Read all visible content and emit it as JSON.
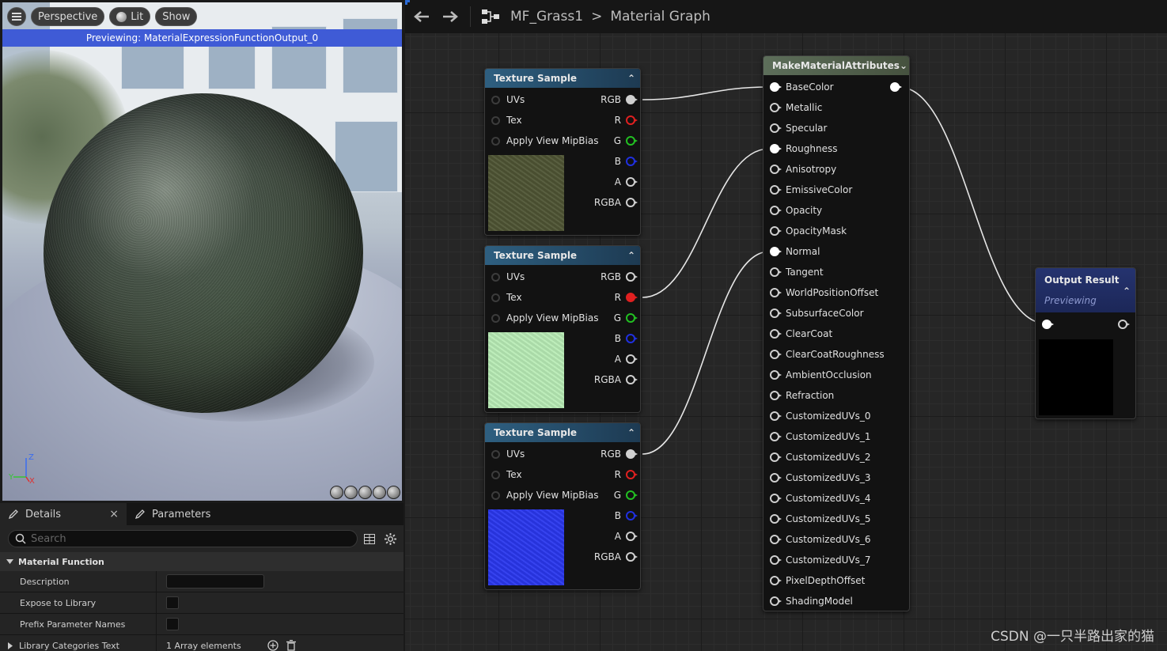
{
  "viewport": {
    "menu_icon": "hamburger-icon",
    "perspective_label": "Perspective",
    "lit_label": "Lit",
    "show_label": "Show",
    "banner": "Previewing: MaterialExpressionFunctionOutput_0",
    "axis": {
      "z": "Z",
      "y": "Y",
      "x": "X"
    }
  },
  "details": {
    "tabs": [
      {
        "label": "Details",
        "close": "×"
      },
      {
        "label": "Parameters"
      }
    ],
    "search_placeholder": "Search",
    "section": "Material Function",
    "rows": [
      {
        "label": "Description"
      },
      {
        "label": "Expose to Library"
      },
      {
        "label": "Prefix Parameter Names"
      },
      {
        "label": "Library Categories Text",
        "value": "1 Array elements"
      }
    ]
  },
  "graph": {
    "asset": "MF_Grass1",
    "sep": ">",
    "title": "Material Graph",
    "texture_nodes": [
      {
        "title": "Texture Sample",
        "inputs": [
          "UVs",
          "Tex",
          "Apply View MipBias"
        ],
        "outputs": [
          "RGB",
          "R",
          "G",
          "B",
          "A",
          "RGBA"
        ],
        "swatch": "#4f5534"
      },
      {
        "title": "Texture Sample",
        "inputs": [
          "UVs",
          "Tex",
          "Apply View MipBias"
        ],
        "outputs": [
          "RGB",
          "R",
          "G",
          "B",
          "A",
          "RGBA"
        ],
        "swatch": "#b9ecb6"
      },
      {
        "title": "Texture Sample",
        "inputs": [
          "UVs",
          "Tex",
          "Apply View MipBias"
        ],
        "outputs": [
          "RGB",
          "R",
          "G",
          "B",
          "A",
          "RGBA"
        ],
        "swatch": "#2a37ee"
      }
    ],
    "mma_node": {
      "title": "MakeMaterialAttributes",
      "inputs": [
        "BaseColor",
        "Metallic",
        "Specular",
        "Roughness",
        "Anisotropy",
        "EmissiveColor",
        "Opacity",
        "OpacityMask",
        "Normal",
        "Tangent",
        "WorldPositionOffset",
        "SubsurfaceColor",
        "ClearCoat",
        "ClearCoatRoughness",
        "AmbientOcclusion",
        "Refraction",
        "CustomizedUVs_0",
        "CustomizedUVs_1",
        "CustomizedUVs_2",
        "CustomizedUVs_3",
        "CustomizedUVs_4",
        "CustomizedUVs_5",
        "CustomizedUVs_6",
        "CustomizedUVs_7",
        "PixelDepthOffset",
        "ShadingModel"
      ]
    },
    "output_node": {
      "title": "Output Result",
      "subtitle": "Previewing"
    },
    "colors": {
      "r": "#e02020",
      "g": "#22c022",
      "b": "#2030e0",
      "wire": "#e6e6e6"
    }
  },
  "watermark": "CSDN @一只半路出家的猫"
}
